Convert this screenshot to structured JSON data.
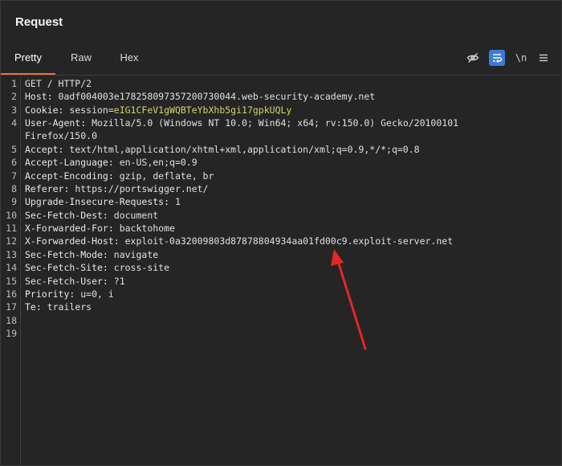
{
  "panel": {
    "title": "Request"
  },
  "tabs": [
    {
      "label": "Pretty",
      "active": true
    },
    {
      "label": "Raw",
      "active": false
    },
    {
      "label": "Hex",
      "active": false
    }
  ],
  "toolbar": {
    "hide_icon": "eye-off-icon",
    "wrap_icon": "wrap-icon",
    "newline_label": "\\n",
    "menu_icon": "menu-icon"
  },
  "request": {
    "l1": "GET / HTTP/2",
    "l2k": "Host:",
    "l2v": " 0adf004003e17825809735720073004​4.web-security-academy.net",
    "l3k": "Cookie:",
    "l3a": " session=",
    "l3v": "eIG1CFeV1gWQBTeYbXhb5gi17gpkUQLy",
    "l4k": "User-Agent:",
    "l4v": " Mozilla/5.0 (Windows NT 10.0; Win64; x64; rv:150.0) Gecko/20100101",
    "l4c": "Firefox/150.0",
    "l5k": "Accept:",
    "l5v": " text/html,application/xhtml+xml,application/xml;q=0.9,*/*;q=0.8",
    "l6k": "Accept-Language:",
    "l6v": " en-US,en;q=0.9",
    "l7k": "Accept-Encoding:",
    "l7v": " gzip, deflate, br",
    "l8k": "Referer:",
    "l8v": " https://portswigger.net/",
    "l9k": "Upgrade-Insecure-Requests:",
    "l9v": " 1",
    "l10k": "Sec-Fetch-Dest:",
    "l10v": " document",
    "l11k": "X-Forwarded-For:",
    "l11v": " backtohome",
    "l12k": "X-Forwarded-Host:",
    "l12v": " exploit-0a32009803d87878804934aa01fd00c9.exploit-server.net",
    "l13k": "Sec-Fetch-Mode:",
    "l13v": " navigate",
    "l14k": "Sec-Fetch-Site:",
    "l14v": " cross-site",
    "l15k": "Sec-Fetch-User:",
    "l15v": " ?1",
    "l16k": "Priority:",
    "l16v": " u=0, i",
    "l17k": "Te:",
    "l17v": " trailers"
  },
  "line_numbers": [
    "1",
    "2",
    "3",
    "4",
    "5",
    "6",
    "7",
    "8",
    "9",
    "10",
    "11",
    "12",
    "13",
    "14",
    "15",
    "16",
    "17",
    "18",
    "19"
  ],
  "colors": {
    "accent": "#e8733a",
    "cookie": "#d6d36a",
    "arrow": "#e32626",
    "wrap_button": "#3d7bd6"
  }
}
